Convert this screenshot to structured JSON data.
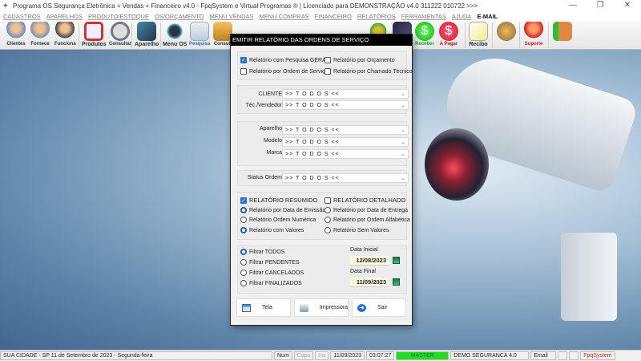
{
  "window": {
    "title": "Programa OS Segurança Eletrônica + Vendas + Financeiro v4.0 - FpqSystem e Virtual Programas ® | Licenciado para  DEMONSTRAÇÃO v4.0 311222 010722 >>>",
    "min": "—",
    "max": "❐",
    "close": "✕"
  },
  "menu": [
    "CADASTROS",
    "APARELHOS",
    "PRODUTO/ESTOQUE",
    "OS/ORÇAMENTO",
    "MENU VENDAS",
    "MENU COMPRAS",
    "FINANCEIRO",
    "RELATÓRIOS",
    "FERRAMENTAS",
    "AJUDA",
    "E-MAIL"
  ],
  "toolbar": [
    "Clientes",
    "Fornece",
    "Funciona",
    "Produtos",
    "Consultar",
    "Aparelho",
    "Menu OS",
    "Pesquisa",
    "Consult",
    "Receber",
    "A Pagar",
    "Recibo",
    "Suporte"
  ],
  "dialog": {
    "title": "EMITIR RELATÓRIO DAS ORDENS DE SERVIÇO",
    "types": [
      {
        "label": "Relatório com Pesquisa GERAL",
        "checked": true
      },
      {
        "label": "Relatório por Orçamento",
        "checked": false
      },
      {
        "label": "Relatório por Ordem de Serviço",
        "checked": false
      },
      {
        "label": "Relatório por Chamado Técnico",
        "checked": false
      }
    ],
    "filters": [
      {
        "label": "CLIENTE",
        "value": ">> T O D O S <<"
      },
      {
        "label": "Téc./Vendedor",
        "value": ">> T O D O S <<"
      },
      {
        "label": "Aparelho",
        "value": ">> T O D O S <<"
      },
      {
        "label": "Modelo",
        "value": ">> T O D O S <<"
      },
      {
        "label": "Marca",
        "value": ">> T O D O S <<"
      },
      {
        "label": "Status Ordem",
        "value": ">> T O D O S <<"
      }
    ],
    "resumido": {
      "label": "RELATÓRIO RESUMIDO",
      "checked": true
    },
    "detalhado": {
      "label": "RELATÓRIO DETALHADO",
      "checked": false
    },
    "order_left": [
      "Relatório por Data de Emissão",
      "Relatório Ordem Numérica",
      "Relatório com Valores"
    ],
    "order_right": [
      "Relatório por Data de Entrega",
      "Relatório por Ordem Alfabética",
      "Relatório Sem Valores"
    ],
    "status_filters": [
      "Filtrar TODOS",
      "Filtrar PENDENTES",
      "Filtrar CANCELADOS",
      "Filtrar FINALIZADOS"
    ],
    "data_inicial_label": "Data Inicial",
    "data_inicial": "12/08/2023",
    "data_final_label": "Data Final",
    "data_final": "11/09/2023",
    "buttons": {
      "tela": "Tela",
      "impressora": "Impressora",
      "sair": "Sair"
    }
  },
  "status": {
    "city": "SUA CIDADE - SP 11 de Setembro de 2023 - Segunda-feira",
    "num": "Num",
    "caps": "Caps",
    "ins": "Ins",
    "date": "11/09/2023",
    "time": "03:07:27",
    "user": "MASTER",
    "company": "DEMO SEGURANCA 4.0",
    "email": "Email",
    "brand": "FpqSystem"
  },
  "colors": {
    "accent": "#2a6fc9",
    "master": "#22dd22",
    "brand": "#cc2222"
  }
}
